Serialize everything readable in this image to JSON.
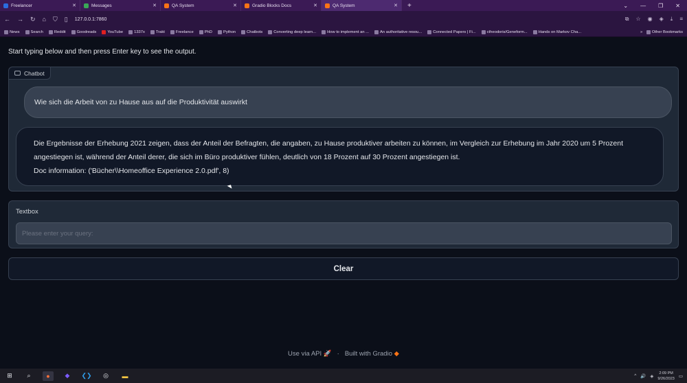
{
  "browser": {
    "tabs": [
      {
        "title": "Freelancer",
        "color": "#2b6cdf",
        "active": false
      },
      {
        "title": "Messages",
        "color": "#3aa757",
        "active": false
      },
      {
        "title": "QA System",
        "color": "#f97316",
        "active": false
      },
      {
        "title": "Gradio Blocks Docs",
        "color": "#f97316",
        "active": false
      },
      {
        "title": "QA System",
        "color": "#f97316",
        "active": true
      }
    ],
    "new_tab": "+",
    "url": "127.0.0.1:7860",
    "bookmarks": [
      "News",
      "Search",
      "Reddit",
      "Goodreads",
      "YouTube",
      "1337x",
      "Trakt",
      "Freelance",
      "PhD",
      "Python",
      "Chatbots",
      "Converting deep learn...",
      "How to implement an ...",
      "An authoritative resou...",
      "Connected Papers | Fi...",
      "ctheodoris/Geneform...",
      "Hands on Markov Cha..."
    ],
    "other_bookmarks": "Other Bookmarks"
  },
  "app": {
    "description": "Start typing below and then press Enter key to see the output.",
    "chatbot_label": "Chatbot",
    "user_message": "Wie sich die Arbeit von zu Hause aus auf die Produktivität auswirkt",
    "bot_message_line1": "Die Ergebnisse der Erhebung 2021 zeigen, dass der Anteil der Befragten, die angaben, zu Hause produktiver arbeiten zu können, im Vergleich zur Erhebung im Jahr 2020 um 5 Prozent angestiegen ist, während der Anteil derer, die sich im Büro produktiver fühlen, deutlich von 18 Prozent auf 30 Prozent angestiegen ist.",
    "bot_message_line2": "Doc information: ('Bücher\\\\Homeoffice Experience 2.0.pdf', 8)",
    "textbox_label": "Textbox",
    "textbox_placeholder": "Please enter your query:",
    "textbox_value": "",
    "clear_label": "Clear",
    "footer_api": "Use via API",
    "footer_sep": "·",
    "footer_built": "Built with Gradio"
  },
  "taskbar": {
    "time": "2:09 PM",
    "date": "9/26/2023"
  }
}
